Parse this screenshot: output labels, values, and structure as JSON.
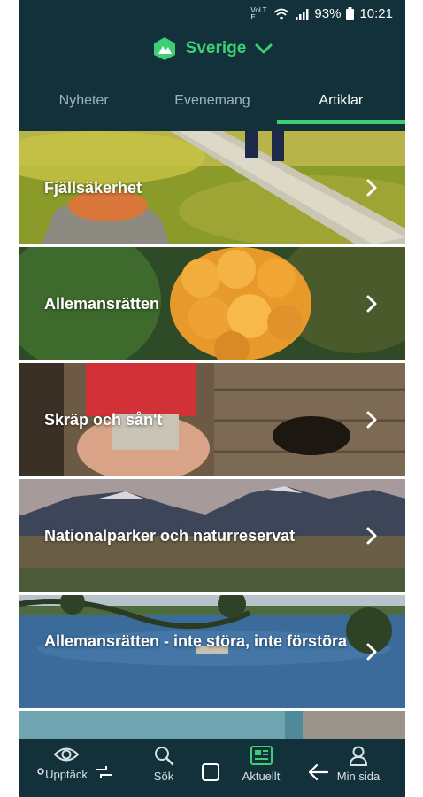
{
  "status": {
    "volte": "VoLTE",
    "battery_pct": "93%",
    "time": "10:21"
  },
  "header": {
    "region": "Sverige"
  },
  "tabs": [
    {
      "label": "Nyheter",
      "active": false
    },
    {
      "label": "Evenemang",
      "active": false
    },
    {
      "label": "Artiklar",
      "active": true
    }
  ],
  "articles": [
    {
      "title": "Fjällsäkerhet"
    },
    {
      "title": "Allemansrätten"
    },
    {
      "title": "Skräp och sån't"
    },
    {
      "title": "Nationalparker och naturreservat"
    },
    {
      "title": "Allemansrätten - inte störa, inte förstöra"
    }
  ],
  "bottom_nav": [
    {
      "label": "Upptäck",
      "icon": "eye-icon"
    },
    {
      "label": "Sök",
      "icon": "search-icon"
    },
    {
      "label": "Aktuellt",
      "icon": "newspaper-icon",
      "active": true
    },
    {
      "label": "Min sida",
      "icon": "user-icon"
    }
  ],
  "colors": {
    "accent": "#3ecf75",
    "header_bg": "#12313b"
  }
}
